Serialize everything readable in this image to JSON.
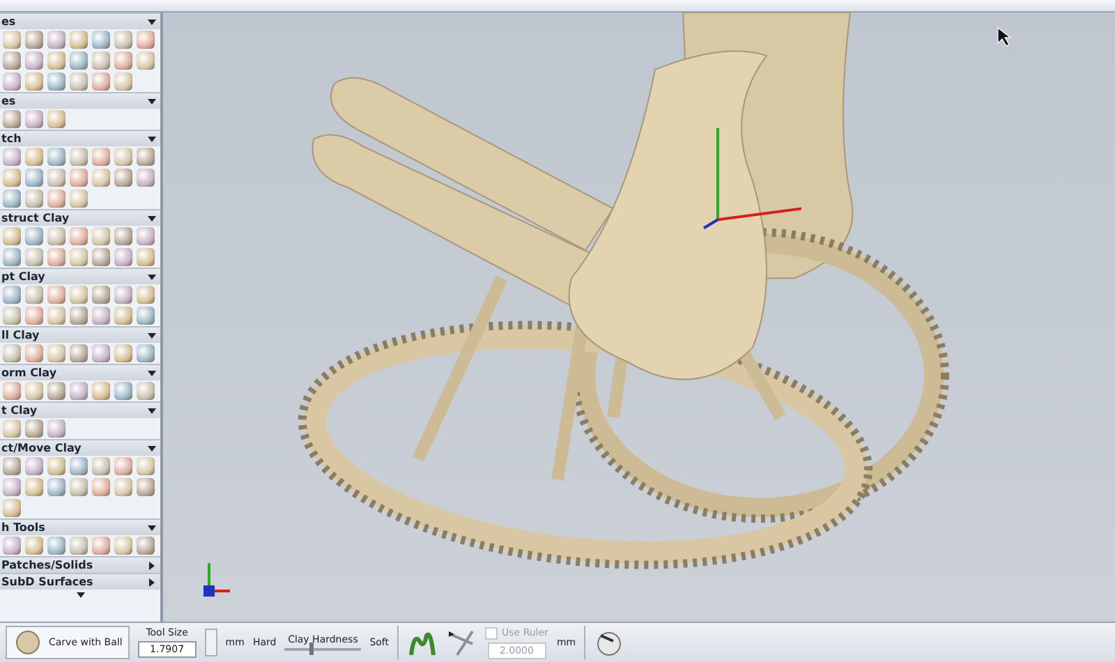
{
  "sidebar": {
    "sections": [
      {
        "title": "es",
        "expanded": true
      },
      {
        "title": "es",
        "expanded": true
      },
      {
        "title": "tch",
        "expanded": true
      },
      {
        "title": "struct Clay",
        "expanded": true
      },
      {
        "title": "pt Clay",
        "expanded": true
      },
      {
        "title": "ll Clay",
        "expanded": true
      },
      {
        "title": "orm Clay",
        "expanded": true
      },
      {
        "title": "t Clay",
        "expanded": true
      },
      {
        "title": "ct/Move Clay",
        "expanded": true
      },
      {
        "title": "h Tools",
        "expanded": true
      },
      {
        "title": "Patches/Solids",
        "expanded": false
      },
      {
        "title": "SubD Surfaces",
        "expanded": false
      }
    ]
  },
  "toolbar": {
    "tool_button": "Carve with Ball",
    "tool_size": {
      "label": "Tool Size",
      "value": "1.7907",
      "unit": "mm"
    },
    "hardness": {
      "label": "Clay Hardness",
      "left": "Hard",
      "right": "Soft",
      "level": 0.35
    },
    "ruler": {
      "label": "Use Ruler",
      "checked": false,
      "disabled": true,
      "value": "2.0000",
      "unit": "mm"
    }
  }
}
